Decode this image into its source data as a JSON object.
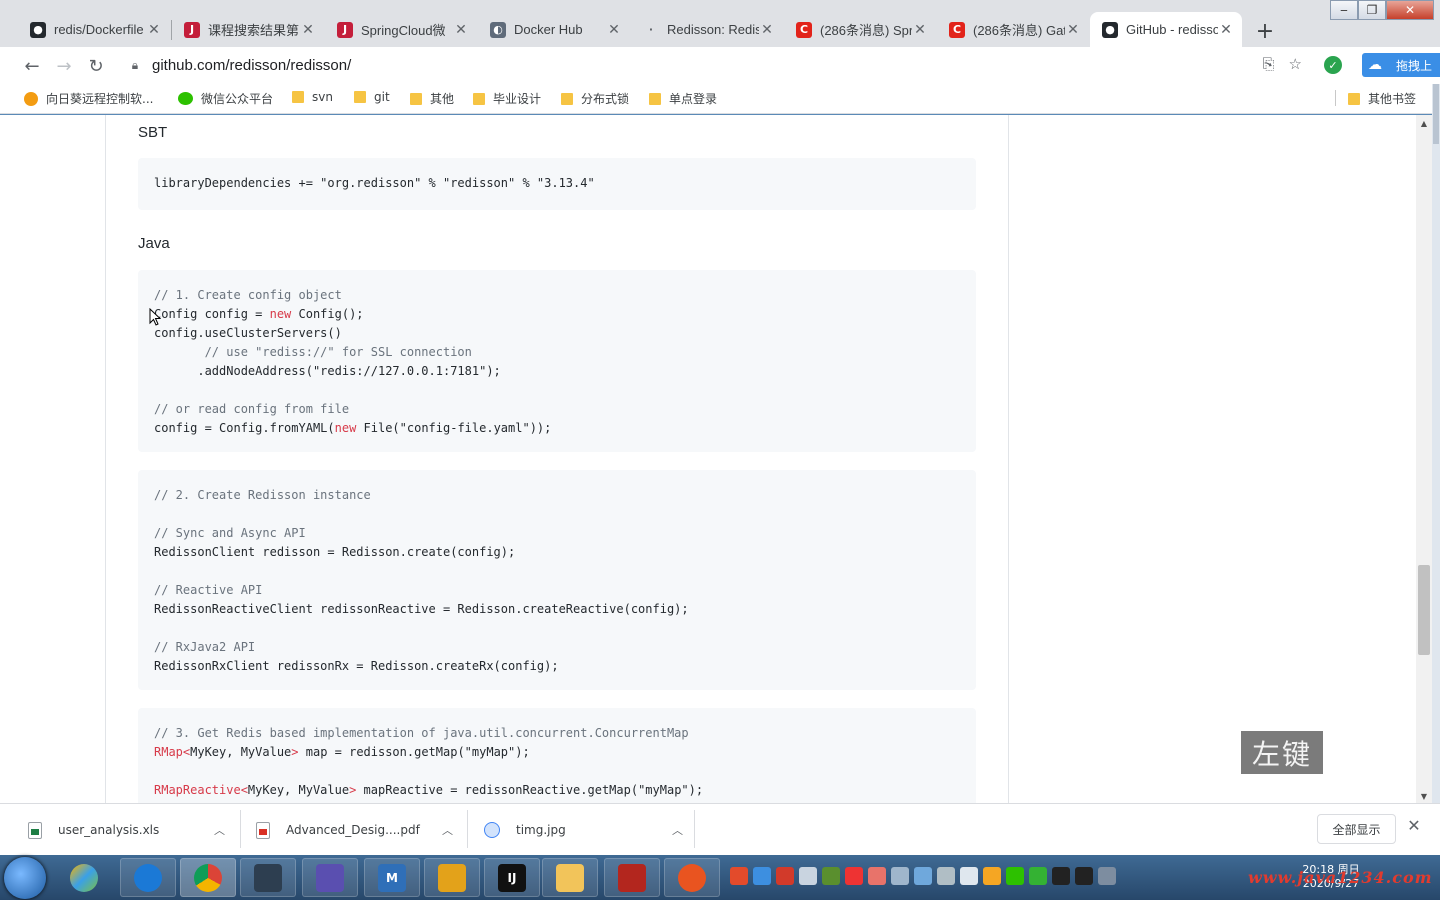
{
  "browser": {
    "tabs": [
      {
        "label": "redis/Dockerfile",
        "icon": "github-icon"
      },
      {
        "label": "课程搜索结果第",
        "icon": "jd-icon"
      },
      {
        "label": "SpringCloud微",
        "icon": "jd-icon"
      },
      {
        "label": "Docker Hub",
        "icon": "docker-hub-icon"
      },
      {
        "label": "Redisson: Redis",
        "icon": "page-icon"
      },
      {
        "label": "(286条消息) Spr",
        "icon": "csdn-icon"
      },
      {
        "label": "(286条消息) Gat",
        "icon": "csdn-icon"
      },
      {
        "label": "GitHub - redisso",
        "icon": "github-icon"
      }
    ],
    "url": "github.com/redisson/redisson/",
    "extension_label": "拖拽上"
  },
  "bookmarks": {
    "items": [
      {
        "label": "向日葵远程控制软..."
      },
      {
        "label": "微信公众平台"
      },
      {
        "label": "svn"
      },
      {
        "label": "git"
      },
      {
        "label": "其他"
      },
      {
        "label": "毕业设计"
      },
      {
        "label": "分布式锁"
      },
      {
        "label": "单点登录"
      }
    ],
    "other": "其他书签"
  },
  "page": {
    "sbt_heading": "SBT",
    "sbt_code": "libraryDependencies += \"org.redisson\" % \"redisson\" % \"3.13.4\"",
    "java_heading": "Java",
    "block1": {
      "c1": "// 1. Create config object",
      "l1a": "Config config = ",
      "l1kw": "new",
      "l1b": " Config();",
      "l2": "config.useClusterServers()",
      "c2": "       // use \"rediss://\" for SSL connection",
      "l3": "      .addNodeAddress(\"redis://127.0.0.1:7181\");",
      "c3": "// or read config from file",
      "l4a": "config = Config.fromYAML(",
      "l4kw": "new",
      "l4b": " File(\"config-file.yaml\"));"
    },
    "block2": {
      "c1": "// 2. Create Redisson instance",
      "c2": "// Sync and Async API",
      "l1": "RedissonClient redisson = Redisson.create(config);",
      "c3": "// Reactive API",
      "l2": "RedissonReactiveClient redissonReactive = Redisson.createReactive(config);",
      "c4": "// RxJava2 API",
      "l3": "RedissonRxClient redissonRx = Redisson.createRx(config);"
    },
    "block3": {
      "c1": "// 3. Get Redis based implementation of java.util.concurrent.ConcurrentMap",
      "l1t": "RMap<",
      "l1a": "MyKey, MyValue",
      "l1t2": ">",
      "l1b": " map = redisson.getMap(\"myMap\");",
      "l2t": "RMapReactive<",
      "l2a": "MyKey, MyValue",
      "l2t2": ">",
      "l2b": " mapReactive = redissonReactive.getMap(\"myMap\");"
    }
  },
  "overlay_key": "左键",
  "downloads": {
    "items": [
      {
        "name": "user_analysis.xls"
      },
      {
        "name": "Advanced_Desig....pdf"
      },
      {
        "name": "timg.jpg"
      }
    ],
    "show_all": "全部显示"
  },
  "taskbar": {
    "time": "20:18 周日",
    "date": "2020/9/27",
    "watermark": "www.java1234.com"
  },
  "colors": {
    "code_bg": "#f6f8fa",
    "comment": "#6a737d",
    "keyword": "#d73a49",
    "tab_strip": "#dfe1e5"
  }
}
